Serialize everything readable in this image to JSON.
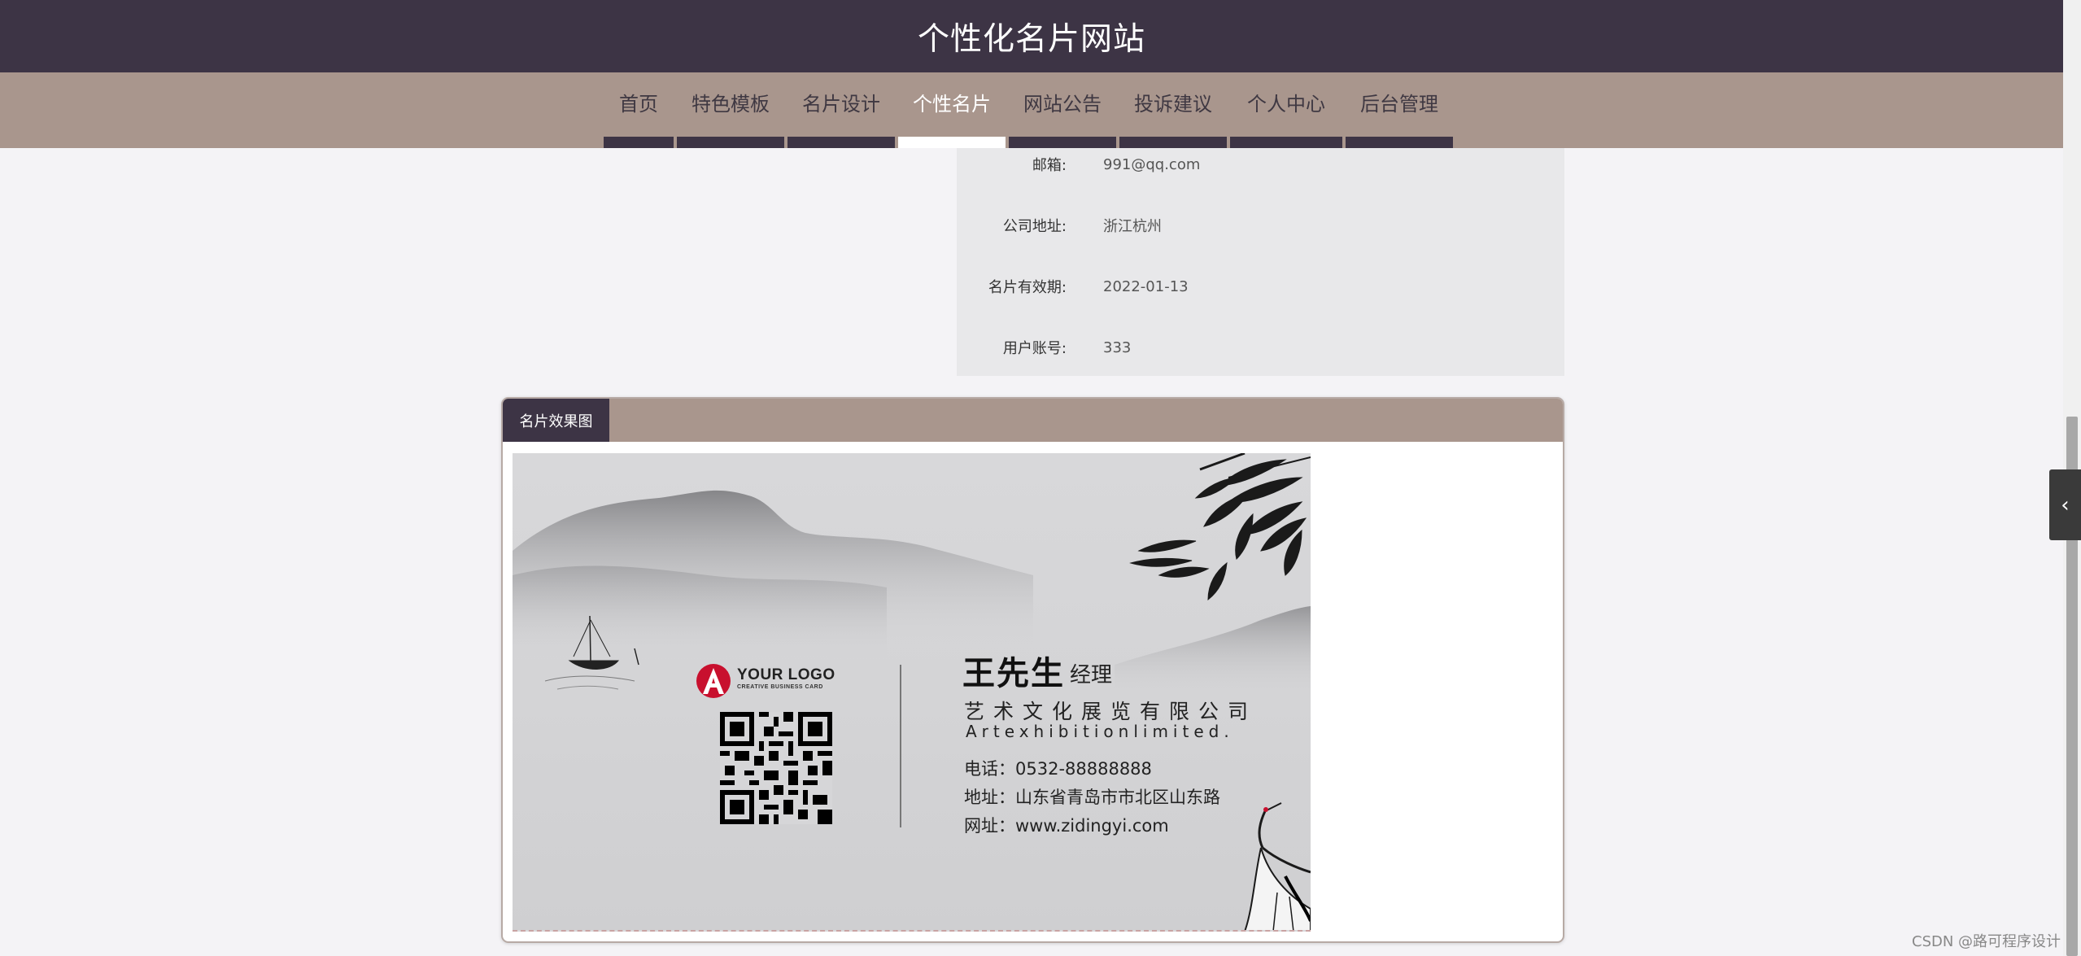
{
  "header": {
    "title": "个性化名片网站"
  },
  "nav": {
    "items": [
      {
        "label": "首页",
        "active": false
      },
      {
        "label": "特色模板",
        "active": false
      },
      {
        "label": "名片设计",
        "active": false
      },
      {
        "label": "个性名片",
        "active": true
      },
      {
        "label": "网站公告",
        "active": false
      },
      {
        "label": "投诉建议",
        "active": false
      },
      {
        "label": "个人中心",
        "active": false
      },
      {
        "label": "后台管理",
        "active": false
      }
    ]
  },
  "info": {
    "rows": [
      {
        "label": "邮箱:",
        "value": "991@qq.com"
      },
      {
        "label": "公司地址:",
        "value": "浙江杭州"
      },
      {
        "label": "名片有效期:",
        "value": "2022-01-13"
      },
      {
        "label": "用户账号:",
        "value": "333"
      }
    ]
  },
  "panel": {
    "tab_label": "名片效果图"
  },
  "card": {
    "logo_text": "YOUR LOGO",
    "logo_sub": "CREATIVE BUSINESS CARD",
    "name": "王先生",
    "title": "经理",
    "company_cn": "艺术文化展览有限公司",
    "company_en": "Artexhibitionlimited.",
    "phone": "电话：0532-88888888",
    "address": "地址：山东省青岛市市北区山东路",
    "website": "网址：www.zidingyi.com"
  },
  "side": {
    "toggle_icon": "‹"
  },
  "watermark": "CSDN @路可程序设计"
}
